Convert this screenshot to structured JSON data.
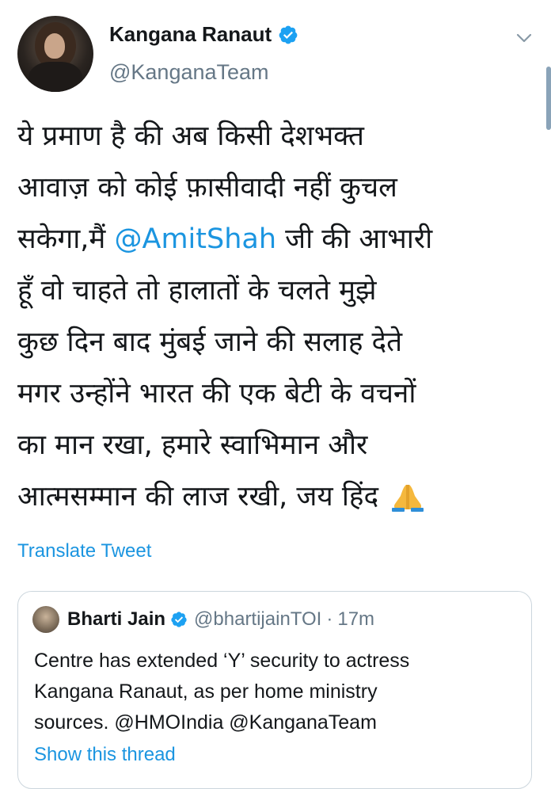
{
  "tweet": {
    "author": {
      "display_name": "Kangana Ranaut",
      "handle": "@KanganaTeam",
      "verified": true
    },
    "text_lines": [
      [
        "ये प्रमाण है की अब किसी देशभक्त"
      ],
      [
        "आवाज़ को कोई फ़ासीवादी नहीं कुचल"
      ],
      [
        "सकेगा,मैं ",
        "@AmitShah",
        " जी की आभारी"
      ],
      [
        "हूँ वो चाहते तो हालातों के चलते मुझे"
      ],
      [
        "कुछ दिन बाद मुंबई जाने की सलाह देते"
      ],
      [
        "मगर उन्होंने भारत की एक बेटी के वचनों"
      ],
      [
        "का मान रखा, हमारे स्वाभिमान और"
      ],
      [
        "आत्मसम्मान की लाज रखी, जय हिंद "
      ]
    ],
    "emoji": "folded-hands-emoji",
    "translate_label": "Translate Tweet"
  },
  "quoted_tweet": {
    "author": {
      "display_name": "Bharti Jain",
      "handle": "@bhartijainTOI",
      "verified": true
    },
    "separator": "·",
    "time": "17m",
    "text_lines": [
      "Centre has extended ‘Y’ security to actress",
      "Kangana Ranaut, as per home ministry",
      "sources. @HMOIndia @KanganaTeam"
    ],
    "show_thread_label": "Show this thread"
  },
  "colors": {
    "link": "#1b95e0",
    "secondary_text": "#657786",
    "verified_badge": "#1da1f2",
    "border": "#ccd6dd"
  },
  "icons": {
    "menu": "chevron-down-icon",
    "verified": "verified-badge-icon"
  }
}
